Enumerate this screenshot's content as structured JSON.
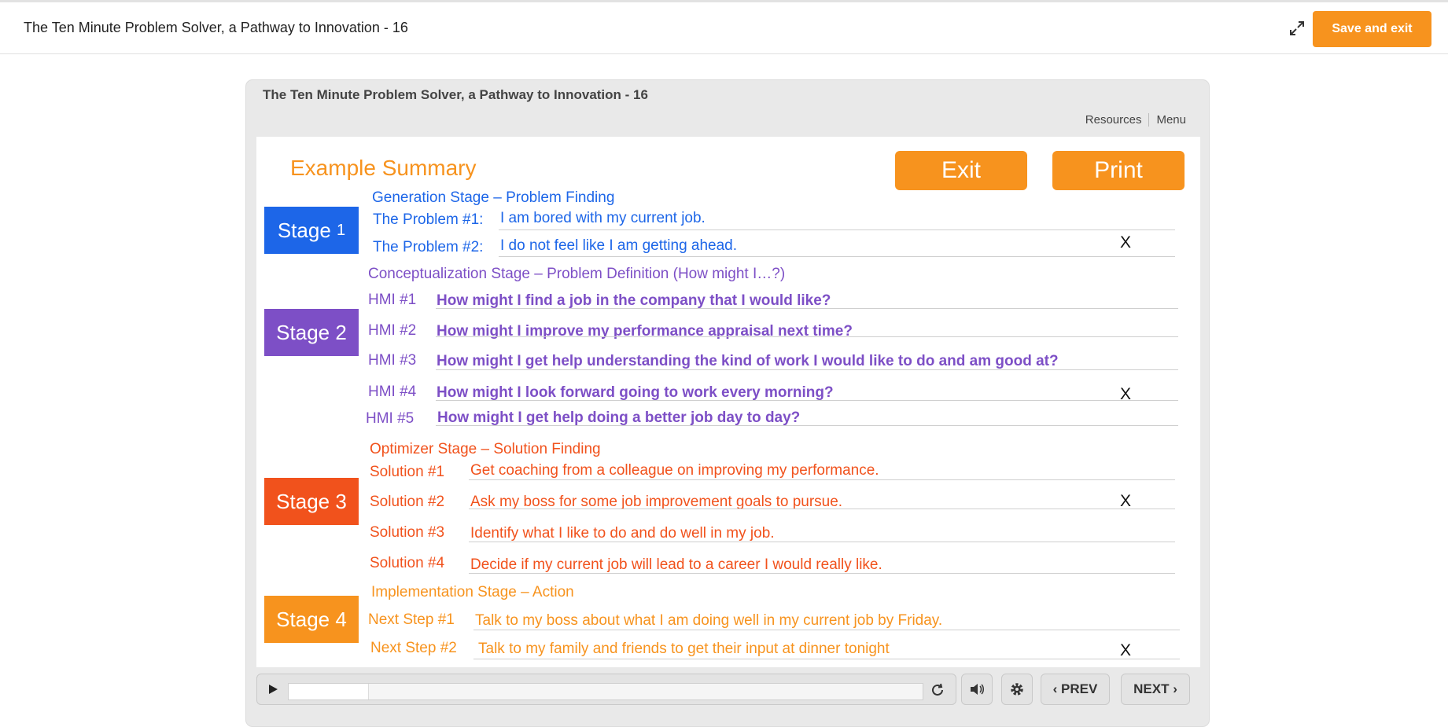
{
  "header": {
    "title": "The Ten Minute Problem Solver, a Pathway to Innovation - 16",
    "save_label": "Save and exit"
  },
  "player": {
    "title": "The Ten Minute Problem Solver, a Pathway to Innovation - 16",
    "links": {
      "resources": "Resources",
      "menu": "Menu"
    },
    "controls": {
      "progress": 0.125,
      "prev": "PREV",
      "next": "NEXT"
    }
  },
  "slide": {
    "heading": "Example Summary",
    "exit_label": "Exit",
    "print_label": "Print",
    "x_mark": "X",
    "stage1": {
      "label": "Stage",
      "num": "1",
      "title": "Generation Stage – Problem Finding",
      "items": [
        {
          "label": "The Problem #1:",
          "value": "I am bored with my current job."
        },
        {
          "label": "The Problem #2:",
          "value": "I do not feel like I am getting ahead."
        }
      ]
    },
    "stage2": {
      "label": "Stage 2",
      "title": "Conceptualization Stage – Problem Definition (How might I…?)",
      "items": [
        {
          "label": "HMI #1",
          "value": "How might I find a job in the company that I would like?"
        },
        {
          "label": "HMI #2",
          "value": "How might I improve my performance appraisal next time?"
        },
        {
          "label": "HMI #3",
          "value": "How might I get help understanding the kind of work I would like to do and am good at?"
        },
        {
          "label": "HMI #4",
          "value": "How might I look forward going to work every morning?"
        },
        {
          "label": "HMI #5",
          "value": "How might I get help doing a better job day to day?"
        }
      ]
    },
    "stage3": {
      "label": "Stage 3",
      "title": "Optimizer Stage – Solution Finding",
      "items": [
        {
          "label": "Solution #1",
          "value": "Get coaching from a colleague on improving my performance."
        },
        {
          "label": "Solution #2",
          "value": "Ask my boss for some job improvement goals to pursue."
        },
        {
          "label": "Solution #3",
          "value": "Identify what I like to do and do well in my job."
        },
        {
          "label": "Solution #4",
          "value": "Decide if my current job will lead to a career I would really like."
        }
      ]
    },
    "stage4": {
      "label": "Stage 4",
      "title": "Implementation Stage – Action",
      "items": [
        {
          "label": "Next Step #1",
          "value": "Talk to my boss about what I am doing well in my current job by Friday."
        },
        {
          "label": "Next Step #2",
          "value": "Talk to my family and friends to get their input at dinner tonight"
        }
      ]
    },
    "colors": {
      "stage1": "#1d66e8",
      "stage2": "#7d4fc6",
      "stage3": "#f1521c",
      "stage4": "#f7931e"
    }
  }
}
